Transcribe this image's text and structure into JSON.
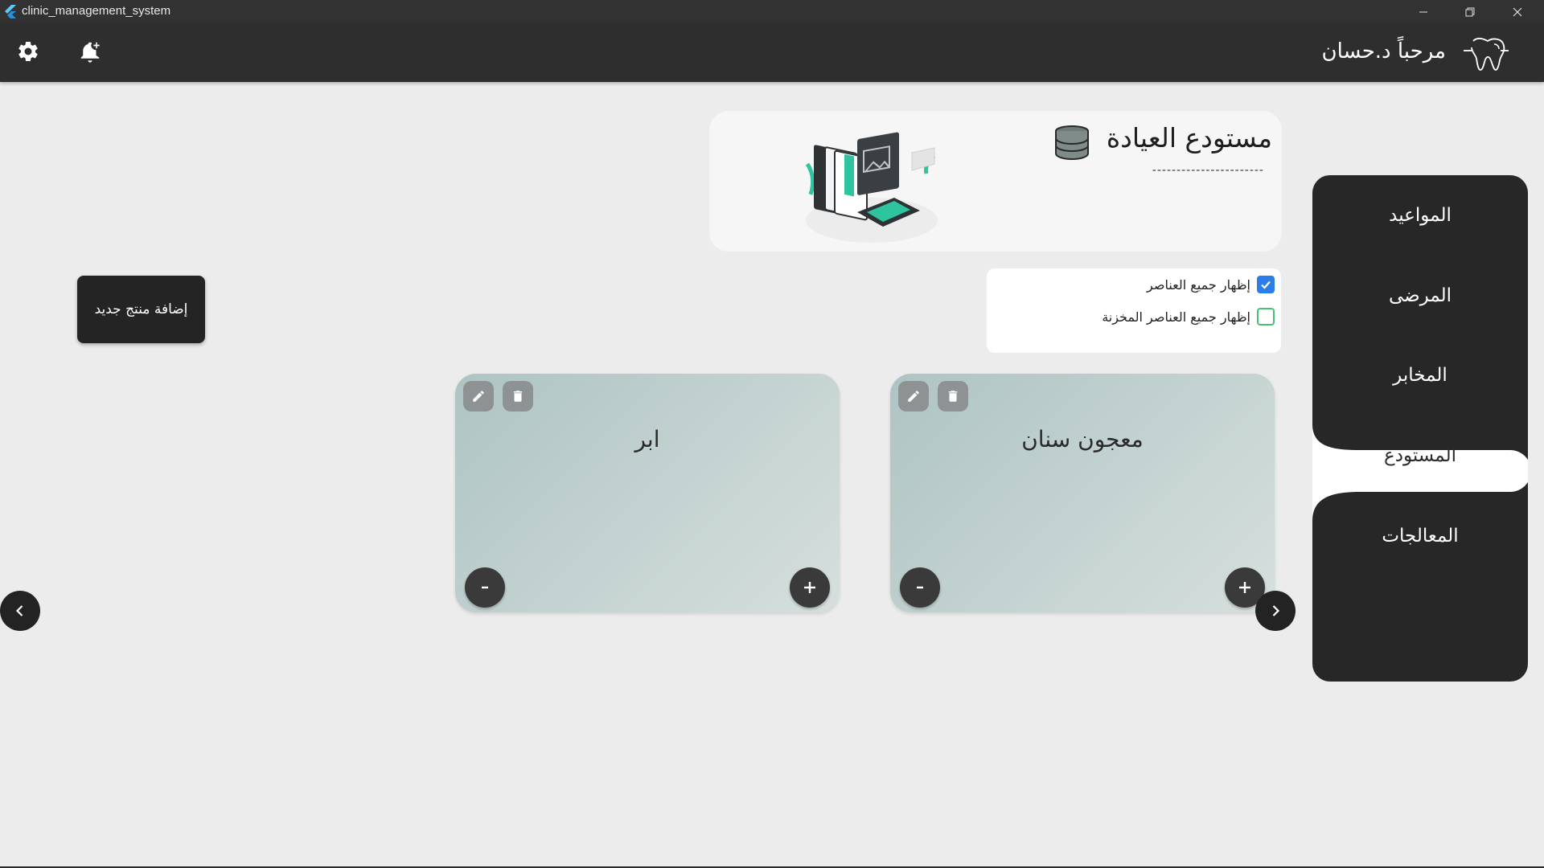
{
  "window": {
    "title": "clinic_management_system"
  },
  "header": {
    "welcome": "مرحباً د.حسان",
    "icons": [
      "settings-icon",
      "notification-add-icon",
      "tooth-logo-icon"
    ]
  },
  "sidebar": {
    "items": [
      {
        "label": "المواعيد",
        "active": false
      },
      {
        "label": "المرضى",
        "active": false
      },
      {
        "label": "المخابر",
        "active": false
      },
      {
        "label": "المستودع",
        "active": true
      },
      {
        "label": "المعالجات",
        "active": false
      }
    ]
  },
  "info_card": {
    "title": "مستودع العيادة",
    "dashes": "-----------------------"
  },
  "filters": [
    {
      "label": "إظهار جميع العناصر",
      "checked": true
    },
    {
      "label": "إظهار جميع العناصر المخزنة",
      "checked": false
    }
  ],
  "add_button": {
    "label": "إضافة منتج جديد"
  },
  "products": [
    {
      "name": "معجون سنان"
    },
    {
      "name": "ابر"
    }
  ],
  "colors": {
    "header_bg": "#2e2e2e",
    "sidebar_bg": "#272727",
    "card_gradient_start": "#aec4c3",
    "checkbox_checked": "#2b7de9",
    "checkbox_border": "#48c07a"
  }
}
